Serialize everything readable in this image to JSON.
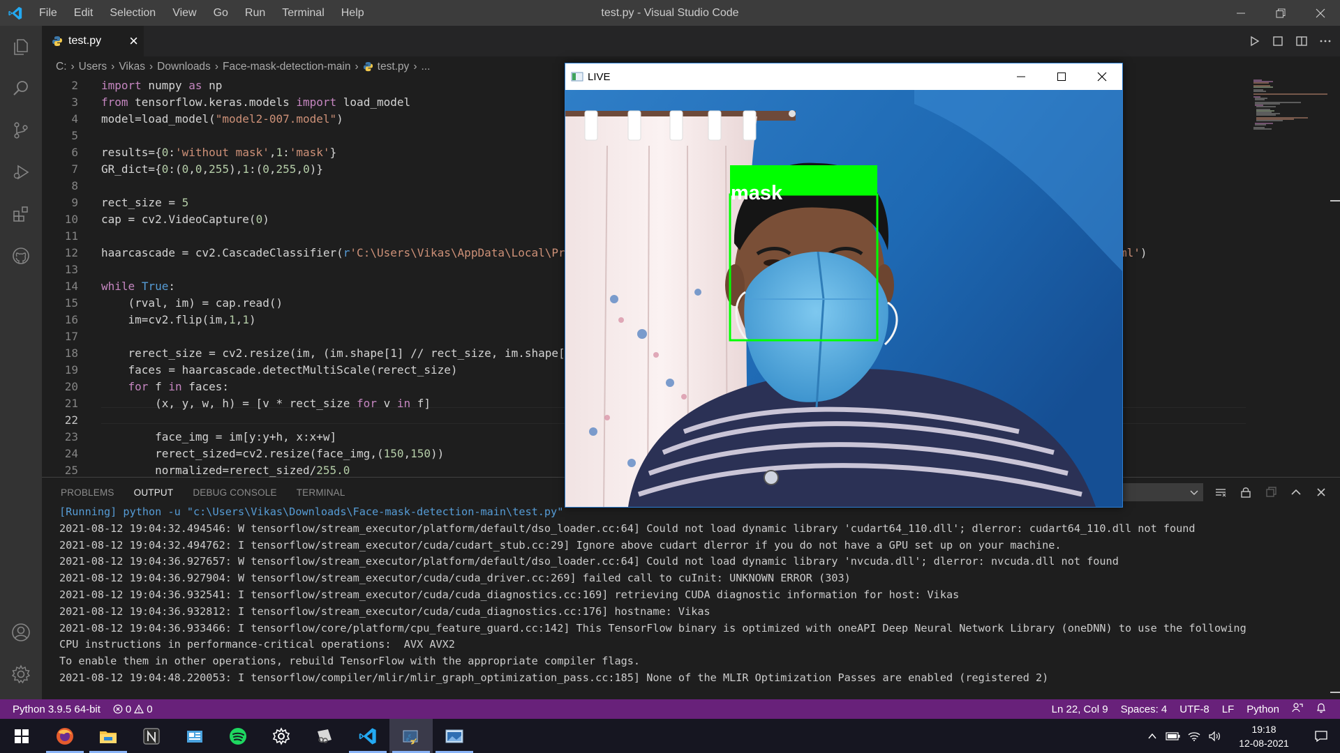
{
  "titlebar": {
    "menu": [
      "File",
      "Edit",
      "Selection",
      "View",
      "Go",
      "Run",
      "Terminal",
      "Help"
    ],
    "window_title": "test.py - Visual Studio Code"
  },
  "tab": {
    "label": "test.py"
  },
  "breadcrumb": {
    "items": [
      "C:",
      "Users",
      "Vikas",
      "Downloads",
      "Face-mask-detection-main",
      "test.py",
      "..."
    ]
  },
  "editor": {
    "current_line": 22,
    "lines": [
      {
        "n": "2"
      },
      {
        "n": "3"
      },
      {
        "n": "4"
      },
      {
        "n": "5"
      },
      {
        "n": "6"
      },
      {
        "n": "7"
      },
      {
        "n": "8"
      },
      {
        "n": "9"
      },
      {
        "n": "10"
      },
      {
        "n": "11"
      },
      {
        "n": "12"
      },
      {
        "n": "13"
      },
      {
        "n": "14"
      },
      {
        "n": "15"
      },
      {
        "n": "16"
      },
      {
        "n": "17"
      },
      {
        "n": "18"
      },
      {
        "n": "19"
      },
      {
        "n": "20"
      },
      {
        "n": "21"
      },
      {
        "n": "22"
      },
      {
        "n": "23"
      },
      {
        "n": "24"
      },
      {
        "n": "25"
      }
    ],
    "code": {
      "l2": [
        "import",
        " numpy ",
        "as",
        " np"
      ],
      "l3": [
        "from",
        " tensorflow.keras.models ",
        "import",
        " load_model"
      ],
      "l4": [
        "model=load_model(",
        "\"model2-007.model\"",
        ")"
      ],
      "l6": [
        "results={",
        "0",
        ":",
        "'without mask'",
        ",",
        "1",
        ":",
        "'mask'",
        "}"
      ],
      "l7": [
        "GR_dict={",
        "0",
        ":(",
        "0",
        ",",
        "0",
        ",",
        "255",
        "),",
        "1",
        ":(",
        "0",
        ",",
        "255",
        ",",
        "0",
        ")}"
      ],
      "l9": [
        "rect_size = ",
        "5"
      ],
      "l10": [
        "cap = cv2.VideoCapture(",
        "0",
        ")"
      ],
      "l12": [
        "haarcascade = cv2.CascadeClassifier(",
        "r",
        "'C:\\Users\\Vikas\\AppData\\Local\\Pr"
      ],
      "l12_tail": "ml')",
      "l14": [
        "while",
        " ",
        "True",
        ":"
      ],
      "l15": "    (rval, im) = cap.read()",
      "l16": [
        "    im=cv2.flip(im,",
        "1",
        ",",
        "1",
        ")"
      ],
      "l18": "    rerect_size = cv2.resize(im, (im.shape[1] // rect_size, im.shape[",
      "l19": "    faces = haarcascade.detectMultiScale(rerect_size)",
      "l20": [
        "    ",
        "for",
        " f ",
        "in",
        " faces:"
      ],
      "l21": [
        "        (x, y, w, h) = [v * rect_size ",
        "for",
        " v ",
        "in",
        " f]"
      ],
      "l23": "        face_img = im[y:y+h, x:x+w]",
      "l24": [
        "        rerect_sized=cv2.resize(face_img,(",
        "150",
        ",",
        "150",
        "))"
      ],
      "l25": [
        "        normalized=rerect_sized/",
        "255.0"
      ]
    }
  },
  "panel": {
    "tabs": [
      "PROBLEMS",
      "OUTPUT",
      "DEBUG CONSOLE",
      "TERMINAL"
    ],
    "active_tab": "OUTPUT",
    "output_lines": [
      "[Running] python -u \"c:\\Users\\Vikas\\Downloads\\Face-mask-detection-main\\test.py\"",
      "2021-08-12 19:04:32.494546: W tensorflow/stream_executor/platform/default/dso_loader.cc:64] Could not load dynamic library 'cudart64_110.dll'; dlerror: cudart64_110.dll not found",
      "2021-08-12 19:04:32.494762: I tensorflow/stream_executor/cuda/cudart_stub.cc:29] Ignore above cudart dlerror if you do not have a GPU set up on your machine.",
      "2021-08-12 19:04:36.927657: W tensorflow/stream_executor/platform/default/dso_loader.cc:64] Could not load dynamic library 'nvcuda.dll'; dlerror: nvcuda.dll not found",
      "2021-08-12 19:04:36.927904: W tensorflow/stream_executor/cuda/cuda_driver.cc:269] failed call to cuInit: UNKNOWN ERROR (303)",
      "2021-08-12 19:04:36.932541: I tensorflow/stream_executor/cuda/cuda_diagnostics.cc:169] retrieving CUDA diagnostic information for host: Vikas",
      "2021-08-12 19:04:36.932812: I tensorflow/stream_executor/cuda/cuda_diagnostics.cc:176] hostname: Vikas",
      "2021-08-12 19:04:36.933466: I tensorflow/core/platform/cpu_feature_guard.cc:142] This TensorFlow binary is optimized with oneAPI Deep Neural Network Library (oneDNN) to use the following",
      "CPU instructions in performance-critical operations:  AVX AVX2",
      "To enable them in other operations, rebuild TensorFlow with the appropriate compiler flags.",
      "2021-08-12 19:04:48.220053: I tensorflow/compiler/mlir/mlir_graph_optimization_pass.cc:185] None of the MLIR Optimization Passes are enabled (registered 2)"
    ]
  },
  "statusbar": {
    "interpreter": "Python 3.9.5 64-bit",
    "errors": "0",
    "warnings": "0",
    "position": "Ln 22, Col 9",
    "spaces": "Spaces: 4",
    "encoding": "UTF-8",
    "eol": "LF",
    "language": "Python"
  },
  "live_window": {
    "title": "LIVE",
    "detection_label": "mask",
    "box_color": "#00ff00"
  },
  "taskbar": {
    "time": "19:18",
    "date": "12-08-2021"
  },
  "colors": {
    "statusbar": "#68217a",
    "accent": "#007acc",
    "keyword": "#c586c0",
    "string": "#ce9178",
    "number": "#b5cea8"
  }
}
